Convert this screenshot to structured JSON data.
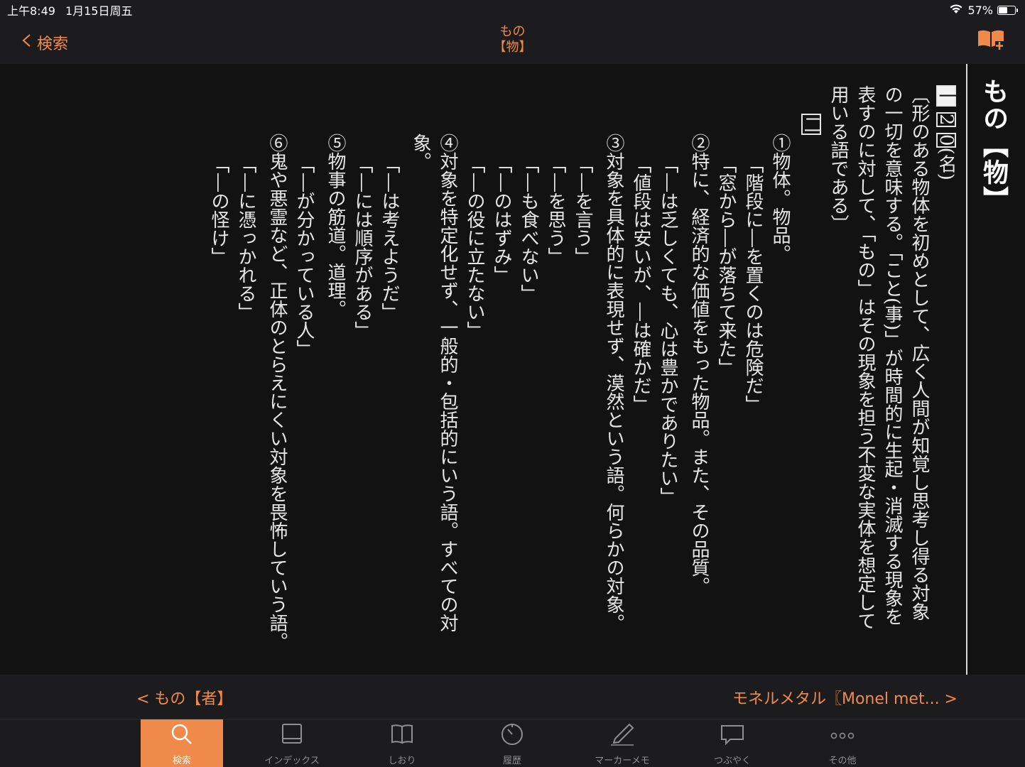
{
  "status_bar": {
    "time": "上午8:49",
    "date": "1月15日周五",
    "battery": "57%",
    "battery_level": 0.57
  },
  "nav": {
    "back_label": "検索",
    "title_reading": "もの",
    "title_kanji": "【物】"
  },
  "entry": {
    "headword": "もの【物】",
    "header_num_1": "2",
    "header_num_2": "0",
    "header_pos": "(名)",
    "section_one": "一",
    "section_two": "二",
    "intro": [
      "〔形のある物体を初めとして、広く人間が知覚し思考し得る対象",
      "の一切を意味する。「こと(事)」が時間的に生起・消滅する現象を",
      "表すのに対して、「もの」はその現象を担う不変な実体を想定して",
      "用いる語である〕"
    ],
    "sense_1": "①物体。物品。",
    "sense_1_ex": [
      "「階段に―を置くのは危険だ」",
      "「窓から―が落ちて来た」"
    ],
    "sense_2": "②特に、経済的な価値をもった物品。また、その品質。",
    "sense_2_ex": [
      "「―は乏しくても、心は豊かでありたい」",
      "「値段は安いが、―は確かだ」"
    ],
    "sense_3": "③対象を具体的に表現せず、漠然という語。何らかの対象。",
    "sense_3_ex": [
      "「―を言う」",
      "「―を思う」",
      "「―も食べない」",
      "「―のはずみ」",
      "「―の役に立たない」"
    ],
    "sense_4": "④対象を特定化せず、一般的・包括的にいう語。すべての対象。",
    "sense_4_ex": [
      "「―は考えようだ」",
      "「―には順序がある」"
    ],
    "sense_5": "⑤物事の筋道。道理。",
    "sense_5_ex": [
      "「―が分かっている人」"
    ],
    "sense_6": "⑥鬼や悪霊など、正体のとらえにくい対象を畏怖していう語。",
    "sense_6_ex": [
      "「―に憑っかれる」",
      "「―の怪け」"
    ]
  },
  "entry_nav": {
    "prev": "< もの【者】",
    "next": "モネルメタル〖Monel met... >"
  },
  "tabs": [
    {
      "label": "検索",
      "icon": "search-icon"
    },
    {
      "label": "インデックス",
      "icon": "index-icon"
    },
    {
      "label": "しおり",
      "icon": "bookmark-icon"
    },
    {
      "label": "履歴",
      "icon": "history-icon"
    },
    {
      "label": "マーカーメモ",
      "icon": "marker-icon"
    },
    {
      "label": "つぶやく",
      "icon": "tweet-icon"
    },
    {
      "label": "その他",
      "icon": "more-icon"
    }
  ],
  "colors": {
    "accent": "#f08a4b",
    "background": "#121212",
    "bar": "#1c1c1e"
  }
}
